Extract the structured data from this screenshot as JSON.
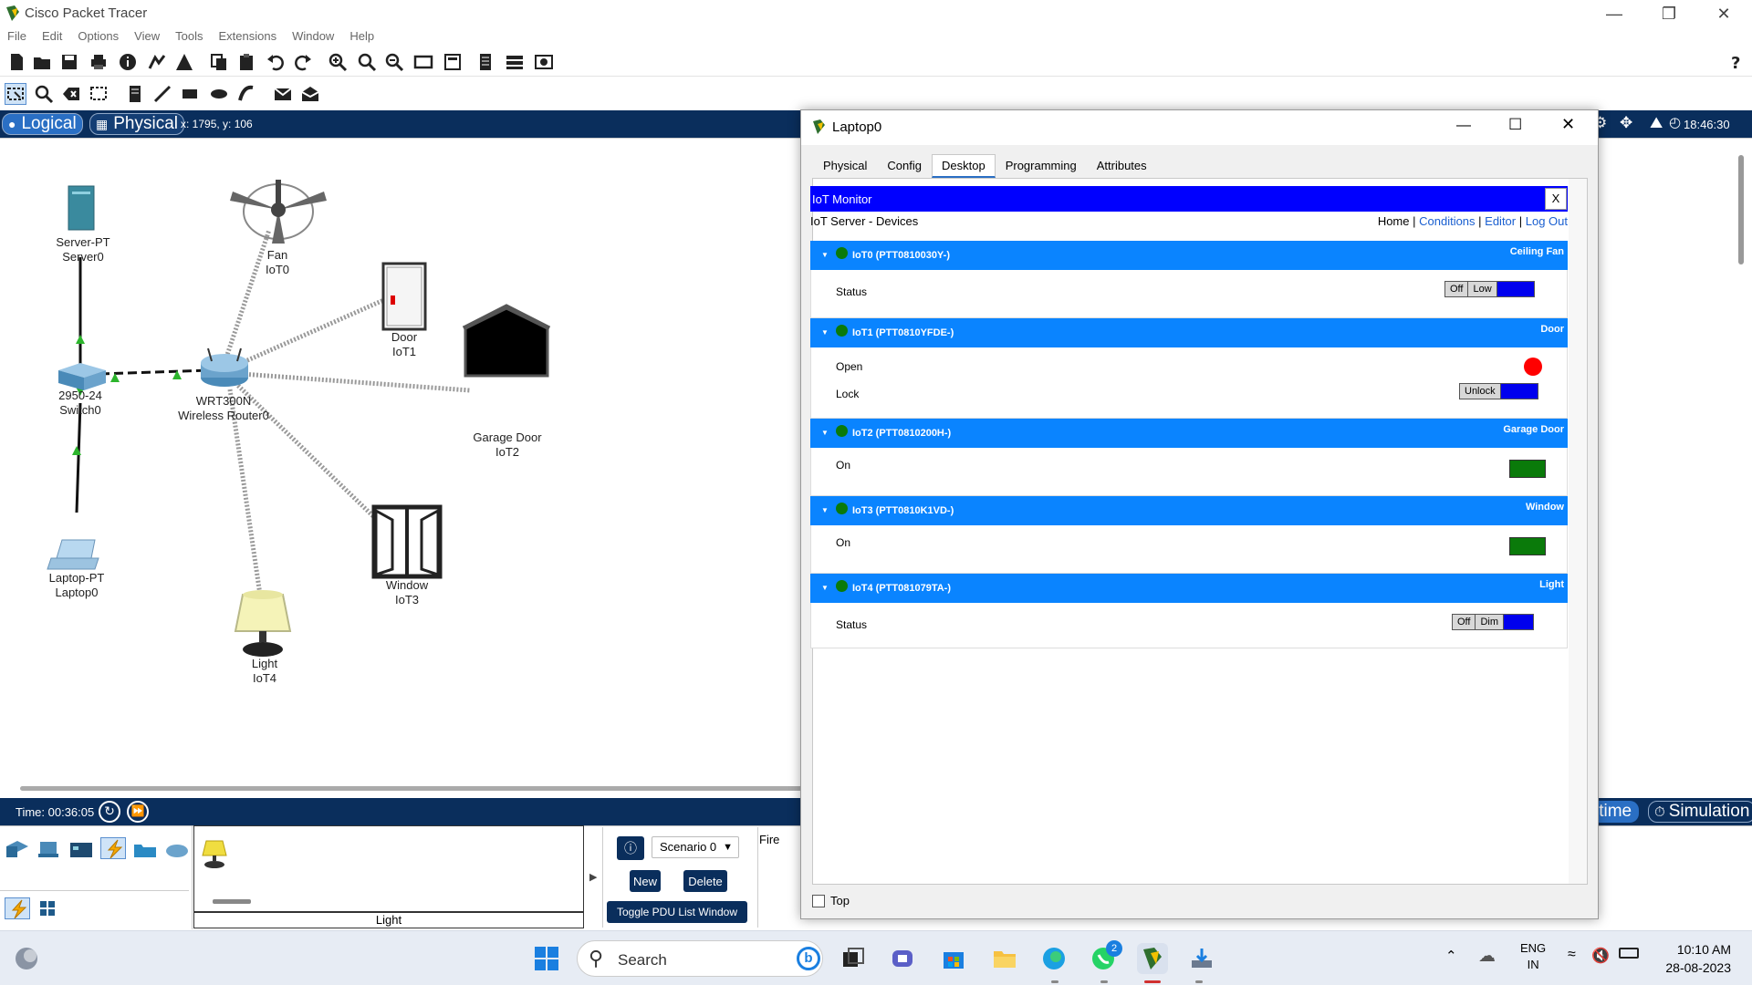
{
  "app": {
    "title": "Cisco Packet Tracer"
  },
  "menu": [
    "File",
    "Edit",
    "Options",
    "View",
    "Tools",
    "Extensions",
    "Window",
    "Help"
  ],
  "modebar": {
    "logical": "Logical",
    "physical": "Physical",
    "coords": "x: 1795, y: 106",
    "clock": "18:46:30"
  },
  "devices": {
    "server": {
      "model": "Server-PT",
      "name": "Server0"
    },
    "fan": {
      "model": "Fan",
      "name": "IoT0"
    },
    "door": {
      "model": "Door",
      "name": "IoT1"
    },
    "garage": {
      "model": "Garage Door",
      "name": "IoT2"
    },
    "switch": {
      "model": "2950-24",
      "name": "Switch0"
    },
    "router": {
      "model": "WRT300N",
      "name": "Wireless Router0"
    },
    "window": {
      "model": "Window",
      "name": "IoT3"
    },
    "laptop": {
      "model": "Laptop-PT",
      "name": "Laptop0"
    },
    "light": {
      "model": "Light",
      "name": "IoT4"
    }
  },
  "timebar": {
    "time": "Time: 00:36:05",
    "realtime": "ltime",
    "simulation": "Simulation"
  },
  "bottom": {
    "scenario": "Scenario 0",
    "new": "New",
    "delete": "Delete",
    "toggle": "Toggle PDU List Window",
    "fire": "Fire",
    "selected_device": "Light"
  },
  "laptopwin": {
    "title": "Laptop0",
    "tabs": [
      "Physical",
      "Config",
      "Desktop",
      "Programming",
      "Attributes"
    ],
    "active_tab": "Desktop",
    "top_checkbox": "Top"
  },
  "iot": {
    "header": "IoT Monitor",
    "close": "X",
    "subtitle": "IoT Server - Devices",
    "nav": {
      "home": "Home",
      "conditions": "Conditions",
      "editor": "Editor",
      "logout": "Log Out"
    },
    "devices": [
      {
        "name": "IoT0 (PTT0810030Y-)",
        "type": "Ceiling Fan",
        "props": [
          {
            "label": "Status",
            "buttons": [
              "Off",
              "Low"
            ]
          }
        ]
      },
      {
        "name": "IoT1 (PTT0810YFDE-)",
        "type": "Door",
        "props": [
          {
            "label": "Open"
          },
          {
            "label": "Lock",
            "buttons": [
              "Unlock"
            ]
          }
        ]
      },
      {
        "name": "IoT2 (PTT0810200H-)",
        "type": "Garage Door",
        "props": [
          {
            "label": "On"
          }
        ]
      },
      {
        "name": "IoT3 (PTT0810K1VD-)",
        "type": "Window",
        "props": [
          {
            "label": "On"
          }
        ]
      },
      {
        "name": "IoT4 (PTT081079TA-)",
        "type": "Light",
        "props": [
          {
            "label": "Status",
            "buttons": [
              "Off",
              "Dim"
            ]
          }
        ]
      }
    ]
  },
  "taskbar": {
    "search": "Search",
    "badge": "2",
    "lang1": "ENG",
    "lang2": "IN",
    "time": "10:10 AM",
    "date": "28-08-2023"
  },
  "colors": {
    "accent": "#0a2e5c",
    "iot_header": "#0000ff",
    "iot_device": "#0a84ff",
    "status_on": "#0a7a0a",
    "status_open": "#ff0000"
  }
}
